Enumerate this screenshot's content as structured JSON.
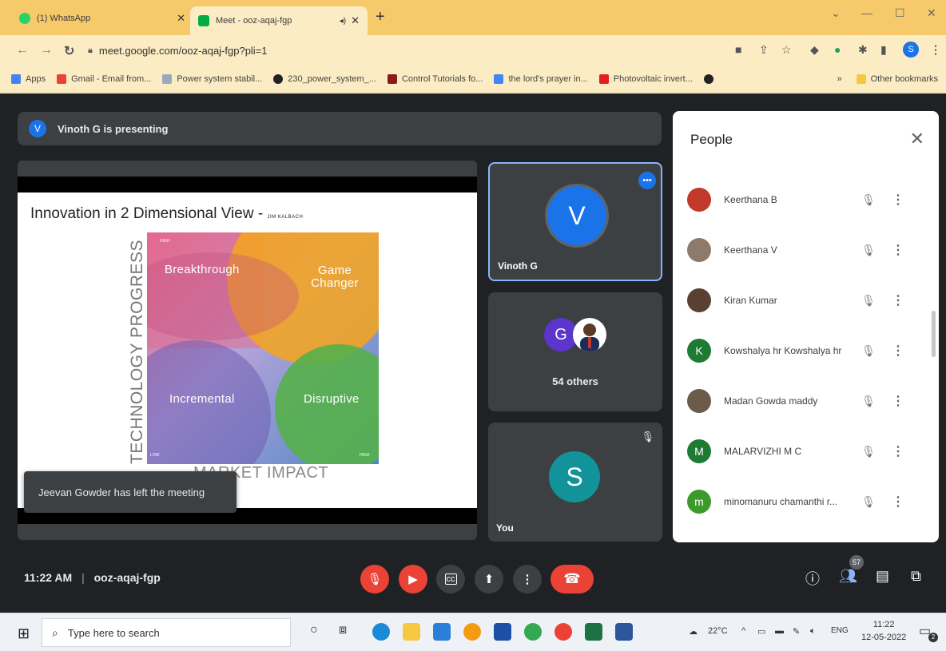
{
  "browser": {
    "tabs": [
      {
        "title": "(1) WhatsApp",
        "favicon_color": "#25d366"
      },
      {
        "title": "Meet - ooz-aqaj-fgp",
        "favicon_color": "#00ac47"
      }
    ],
    "url": "meet.google.com/ooz-aqaj-fgp?pli=1",
    "bookmarks": [
      {
        "label": "Apps",
        "color": "#4285f4"
      },
      {
        "label": "Gmail - Email from...",
        "color": "#ea4335"
      },
      {
        "label": "Power system stabil...",
        "color": "#9ab"
      },
      {
        "label": "230_power_system_...",
        "color": "#222"
      },
      {
        "label": "Control Tutorials fo...",
        "color": "#8b1a1a"
      },
      {
        "label": "the lord's prayer in...",
        "color": "#4285f4"
      },
      {
        "label": "Photovoltaic invert...",
        "color": "#e02020"
      }
    ],
    "other_bookmarks": "Other bookmarks",
    "profile_initial": "S"
  },
  "meet": {
    "presenting_avatar": "V",
    "presenting_text": "Vinoth G is presenting",
    "slide": {
      "title": "Innovation in 2 Dimensional View -",
      "title_credit": "JIM KALBACH",
      "y_axis": "TECHNOLOGY PROGRESS",
      "x_axis": "MARKET IMPACT",
      "quadrants": [
        "Breakthrough",
        "Game Changer",
        "Incremental",
        "Disruptive"
      ],
      "corner_high": "HIGH",
      "corner_low": "LOW"
    },
    "toast": "Jeevan Gowder has left the meeting",
    "tiles": {
      "presenter": {
        "initial": "V",
        "name": "Vinoth G",
        "color": "#1a73e8"
      },
      "others": {
        "initial": "G",
        "label": "54 others",
        "color": "#5c35cc"
      },
      "you": {
        "initial": "S",
        "name": "You",
        "color": "#12939a"
      }
    },
    "people_panel": {
      "title": "People",
      "participants": [
        {
          "name": "Keerthana B",
          "initial": "",
          "color": "#c0392b"
        },
        {
          "name": "Keerthana V",
          "initial": "",
          "color": "#8e7a6a"
        },
        {
          "name": "Kiran Kumar",
          "initial": "",
          "color": "#5a4030"
        },
        {
          "name": "Kowshalya hr Kowshalya hr",
          "initial": "K",
          "color": "#1e7b34"
        },
        {
          "name": "Madan Gowda maddy",
          "initial": "",
          "color": "#6b5b4b"
        },
        {
          "name": "MALARVIZHI M C",
          "initial": "M",
          "color": "#1e7b34"
        },
        {
          "name": "minomanuru chamanthi r...",
          "initial": "m",
          "color": "#3c9a2a"
        }
      ]
    },
    "time": "11:22 AM",
    "meeting_code": "ooz-aqaj-fgp",
    "participant_count": "57"
  },
  "taskbar": {
    "search_placeholder": "Type here to search",
    "weather": "22°C",
    "language": "ENG",
    "time": "11:22",
    "date": "12-05-2022",
    "notification_count": "2"
  }
}
